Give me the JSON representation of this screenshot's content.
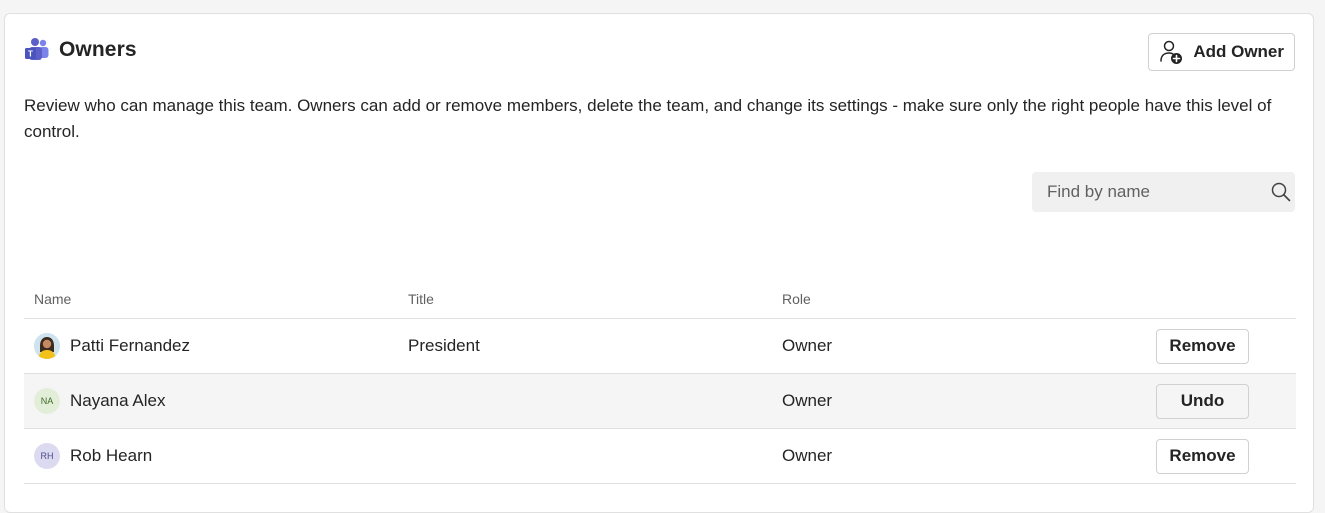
{
  "header": {
    "title": "Owners",
    "add_owner_label": "Add Owner"
  },
  "description": "Review who can manage this team. Owners can add or remove members, delete the team, and change its settings - make sure only the right people have this level of control.",
  "search": {
    "placeholder": "Find by name",
    "value": ""
  },
  "table": {
    "columns": [
      "Name",
      "Title",
      "Role"
    ],
    "rows": [
      {
        "name": "Patti Fernandez",
        "initials": "",
        "title": "President",
        "role": "Owner",
        "action": "Remove",
        "avatar_type": "photo"
      },
      {
        "name": "Nayana Alex",
        "initials": "NA",
        "title": "",
        "role": "Owner",
        "action": "Undo",
        "avatar_type": "initials",
        "avatar_bg": "#e3eed9",
        "avatar_fg": "#3d6b2a"
      },
      {
        "name": "Rob Hearn",
        "initials": "RH",
        "title": "",
        "role": "Owner",
        "action": "Remove",
        "avatar_type": "initials",
        "avatar_bg": "#dcdaf0",
        "avatar_fg": "#4f4a8c"
      }
    ]
  },
  "colors": {
    "teams_brand": "#5b5fc7",
    "border": "#e0e0e0",
    "muted_text": "#616161"
  }
}
